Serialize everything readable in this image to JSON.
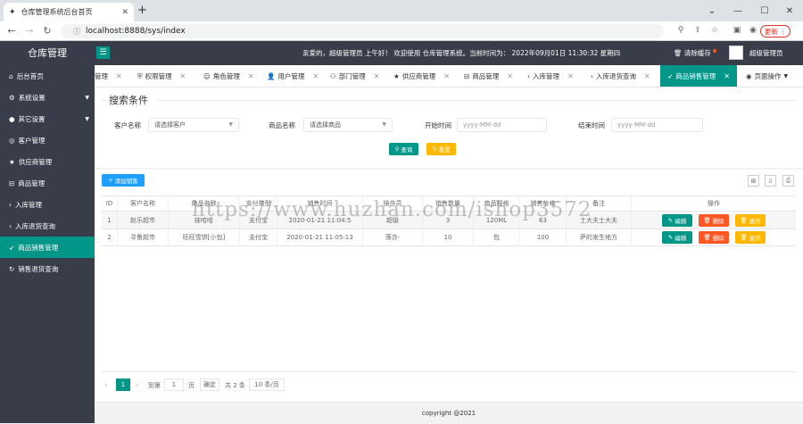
{
  "browser": {
    "tab_title": "仓库管理系统后台首页",
    "new_tab": "+",
    "url": "localhost:8888/sys/index",
    "update_label": "更新"
  },
  "header": {
    "logo": "仓库管理",
    "welcome": "亲爱的，超级管理员 上午好！ 欢迎使用 仓库管理系统。当前时间为： 2022年09月01日 11:30:32  星期四",
    "clear_cache": "清除缓存",
    "admin": "超级管理员"
  },
  "sidebar": {
    "items": [
      {
        "label": "后台首页",
        "icon": "home-icon"
      },
      {
        "label": "系统设置",
        "icon": "gear-icon"
      },
      {
        "label": "其它设置",
        "icon": "circle-icon"
      },
      {
        "label": "客户管理",
        "icon": "user-circle-icon"
      },
      {
        "label": "供应商管理",
        "icon": "star-icon"
      },
      {
        "label": "商品管理",
        "icon": "cart-icon"
      },
      {
        "label": "入库管理",
        "icon": "arrow-right-icon"
      },
      {
        "label": "入库退货查询",
        "icon": "arrow-left-icon"
      },
      {
        "label": "商品销售管理",
        "icon": "send-icon"
      },
      {
        "label": "销售退货查询",
        "icon": "refresh-icon"
      }
    ]
  },
  "tabs": [
    {
      "label": "管理",
      "icon": ""
    },
    {
      "label": "权限管理",
      "icon": "shield-icon"
    },
    {
      "label": "角色管理",
      "icon": "smile-icon"
    },
    {
      "label": "用户管理",
      "icon": "user-icon"
    },
    {
      "label": "部门管理",
      "icon": "group-icon"
    },
    {
      "label": "供应商管理",
      "icon": "star-icon"
    },
    {
      "label": "商品管理",
      "icon": "cart-icon"
    },
    {
      "label": "入库管理",
      "icon": "arrow-right-icon"
    },
    {
      "label": "入库退货查询",
      "icon": "arrow-left-icon"
    },
    {
      "label": "商品销售管理",
      "icon": "send-icon"
    }
  ],
  "page_ops": "页面操作",
  "search": {
    "legend": "搜索条件",
    "customer_label": "客户名称",
    "customer_placeholder": "请选择客户",
    "goods_label": "商品名称",
    "goods_placeholder": "请选择商品",
    "start_label": "开始时间",
    "start_placeholder": "yyyy-MM-dd",
    "end_label": "结束时间",
    "end_placeholder": "yyyy-MM-dd",
    "query_btn": "查询",
    "reset_btn": "重置"
  },
  "table": {
    "add_btn": "添加销售",
    "columns": [
      "ID",
      "客户名称",
      "商品名称",
      "支付类型",
      "销售时间",
      "操作员",
      "销售数量",
      "商品规格",
      "销售价格",
      "备注",
      "操作"
    ],
    "rows": [
      {
        "id": "1",
        "customer": "赵乐超市",
        "goods": "娃哈哈",
        "pay": "支付宝",
        "time": "2020-01-21 11:04:5",
        "operator": "超级",
        "qty": "3",
        "spec": "120ML",
        "price": "63",
        "remark": "士大夫士大夫"
      },
      {
        "id": "2",
        "customer": "寻鲁超市",
        "goods": "旺旺雪饼[小包]",
        "pay": "支付宝",
        "time": "2020-01-21 11:05:13",
        "operator": "落亦-",
        "qty": "10",
        "spec": "包",
        "price": "100",
        "remark": "萨的发生地方"
      }
    ],
    "edit_btn": "编辑",
    "delete_btn": "删除",
    "return_btn": "退货"
  },
  "pager": {
    "prev": "‹",
    "current": "1",
    "next": "›",
    "goto": "到第",
    "page_input": "1",
    "page_unit": "页",
    "confirm": "确定",
    "total": "共 2 条",
    "per_page": "10 条/页"
  },
  "footer": "copyright @2021",
  "watermark": "https://www.huzhan.com/ishop3572",
  "colors": {
    "accent": "#009688",
    "danger": "#ff5722",
    "warn": "#ffb800",
    "blue": "#1e9fff",
    "dark": "#393d49"
  }
}
